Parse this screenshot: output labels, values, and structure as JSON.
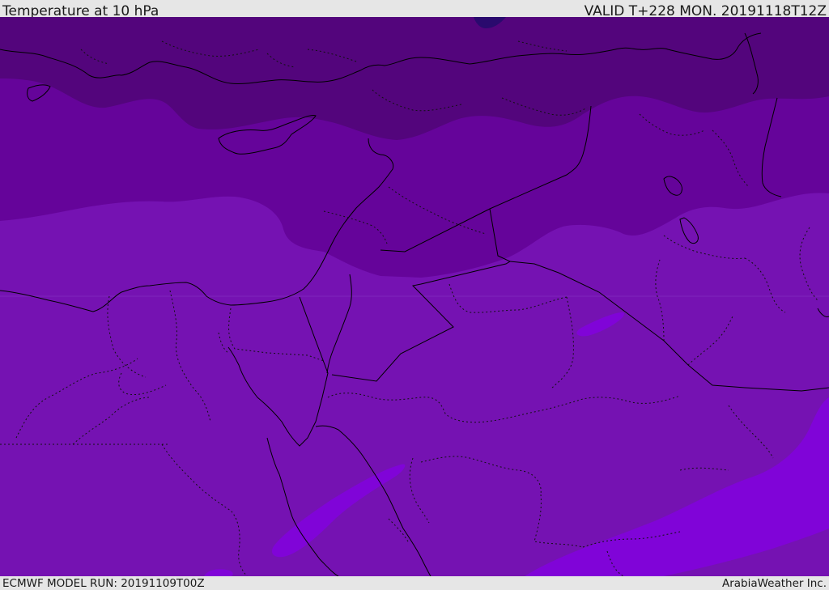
{
  "header": {
    "title": "Temperature at 10 hPa",
    "valid": "VALID T+228 MON. 20191118T12Z"
  },
  "footer": {
    "model_run": "ECMWF MODEL RUN: 20191109T00Z",
    "credit": "ArabiaWeather Inc."
  },
  "map": {
    "colors": {
      "band_darkest": "#2a0a6e",
      "band_dark": "#53057c",
      "band_mid": "#65049a",
      "band_main": "#7512b2",
      "band_light": "#8004d8",
      "border": "#000000"
    }
  }
}
